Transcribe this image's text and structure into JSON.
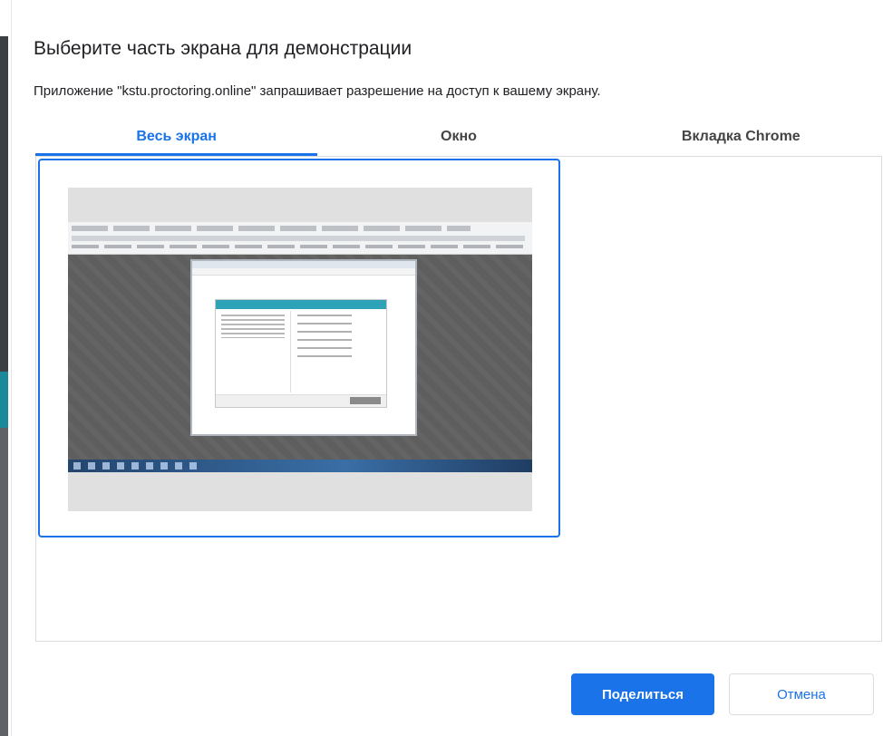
{
  "dialog": {
    "title": "Выберите часть экрана для демонстрации",
    "subtitle": "Приложение \"kstu.proctoring.online\" запрашивает разрешение на доступ к вашему экрану."
  },
  "tabs": [
    {
      "label": "Весь экран",
      "active": true
    },
    {
      "label": "Окно",
      "active": false
    },
    {
      "label": "Вкладка Chrome",
      "active": false
    }
  ],
  "buttons": {
    "share": "Поделиться",
    "cancel": "Отмена"
  },
  "colors": {
    "accent": "#1a73e8"
  }
}
